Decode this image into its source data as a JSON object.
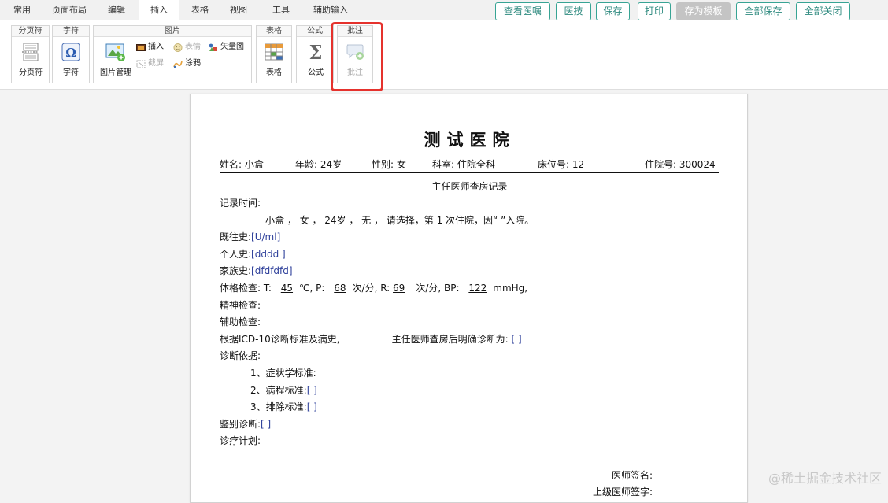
{
  "tabs": [
    "常用",
    "页面布局",
    "编辑",
    "插入",
    "表格",
    "视图",
    "工具",
    "辅助输入"
  ],
  "active_tab": "插入",
  "actions": {
    "view_orders": "查看医嘱",
    "medtech": "医技",
    "save": "保存",
    "print": "打印",
    "save_template": "存为模板",
    "save_all": "全部保存",
    "close_all": "全部关闭"
  },
  "ribbon": {
    "pagebreak": {
      "title": "分页符",
      "button": "分页符"
    },
    "char": {
      "title": "字符",
      "button": "字符"
    },
    "picture": {
      "title": "图片",
      "manage": "图片管理",
      "insert": "插入",
      "emoji": "表情",
      "vector": "矢量图",
      "screenshot": "截屏",
      "doodle": "涂鸦"
    },
    "table": {
      "title": "表格",
      "button": "表格"
    },
    "formula": {
      "title": "公式",
      "button": "公式"
    },
    "comment": {
      "title": "批注",
      "button": "批注"
    }
  },
  "document": {
    "title": "测试医院",
    "patient": {
      "name": "姓名: 小盒",
      "age": "年龄: 24岁",
      "gender": "性别: 女",
      "dept": "科室: 住院全科",
      "bed": "床位号: 12",
      "admission": "住院号: 300024"
    },
    "subtitle": "主任医师查房记录",
    "record_time": "记录时间:",
    "summary": "小盒 ， 女 ， 24岁 ， 无 ， 请选择，第 1 次住院，因“ ”入院。",
    "past_history_label": "既往史:",
    "past_history_value": "[U/ml]",
    "personal_history_label": "个人史:",
    "personal_history_value": "[dddd ]",
    "family_history_label": "家族史:",
    "family_history_value": "[dfdfdfd]",
    "vitals_label": "体格检查: T:",
    "t_value": "45",
    "t_unit": "℃, P:",
    "p_value": "68",
    "p_unit": "次/分, R:",
    "r_value": "69",
    "r_unit": "次/分, BP:",
    "bp_value": "122",
    "bp_unit": "mmHg,",
    "mental_exam": "精神检查:",
    "aux_exam": "辅助检查:",
    "diagnosis_prefix": "根据ICD-10诊断标准及病史,",
    "diagnosis_suffix": "主任医师查房后明确诊断为:",
    "diagnosis_value": "[ ]",
    "diagnosis_basis": "诊断依据:",
    "basis_1": "1、症状学标准:",
    "basis_2_label": "2、病程标准:",
    "basis_2_value": "[ ]",
    "basis_3_label": "3、排除标准:",
    "basis_3_value": "[ ]",
    "differential_label": "鉴别诊断:",
    "differential_value": "[ ]",
    "plan": "诊疗计划:",
    "doctor_sign": "医师签名:",
    "senior_sign": "上级医师签字:"
  },
  "watermark": "@稀土掘金技术社区",
  "colors": {
    "accent": "#37a494",
    "highlight": "#e5322d",
    "bracket": "#2d3f9a"
  }
}
